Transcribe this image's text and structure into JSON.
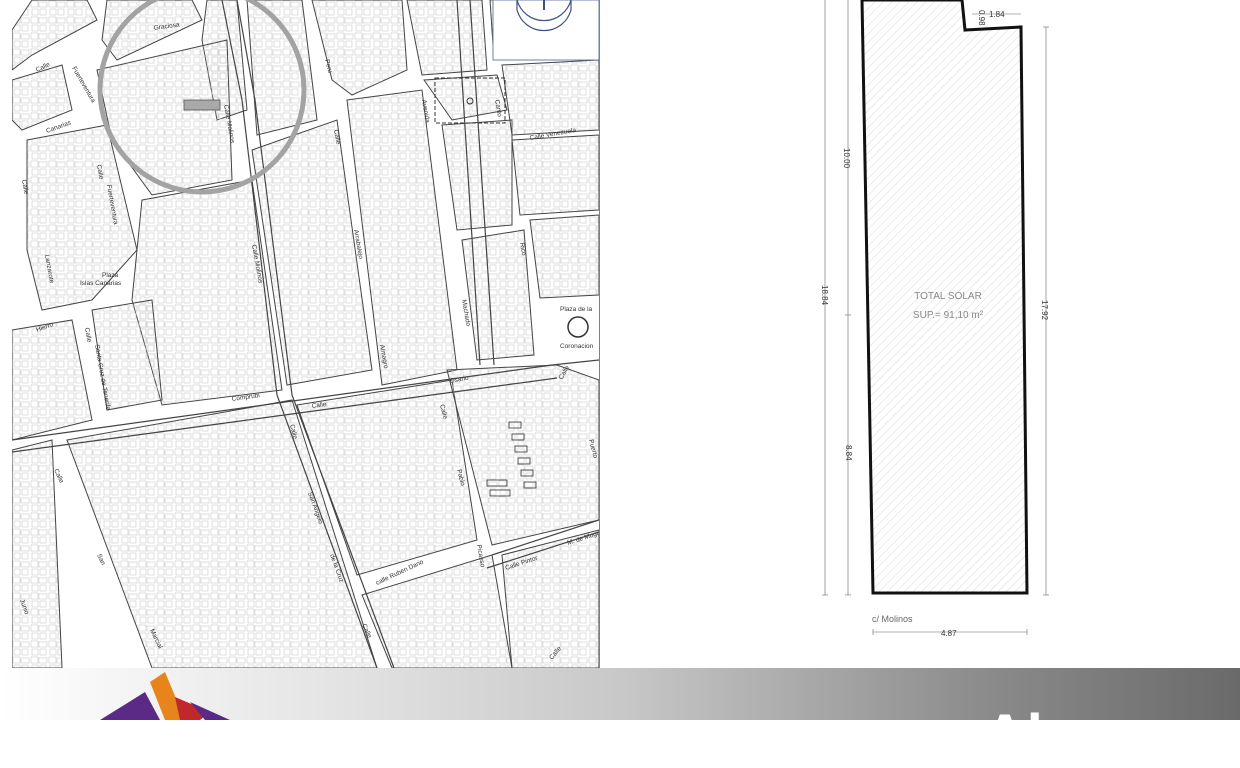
{
  "map": {
    "streets": {
      "graciosa": "Graciosa",
      "calle": "Calle",
      "fuerteventura": "Fuerteventura",
      "canarias": "Canarias",
      "calle_molinos": "Calle Molinos",
      "peru": "Peru",
      "avenida": "Avenida",
      "canto": "Canto",
      "calle_venezuela": "Calle Venezuela",
      "arrabalejo": "Arrabalejo",
      "almagro": "Almagro",
      "machado": "Machado",
      "rico": "Rico",
      "lanzarote": "Lanzarote",
      "plaza_islas_1": "Plaza",
      "plaza_islas_2": "Islas Canarias",
      "hierro": "Hierro",
      "santa_cruz": "Santa Cruz de Tenerife",
      "plaza_coronacion_1": "Plaza de la",
      "plaza_coronacion_2": "Coronacion",
      "osario": "Osario",
      "comprubi": "Comprubi",
      "puerto": "Puerto",
      "pablo": "Pablo",
      "san_angelo": "San Angelo",
      "de_la_cruz": "de la Cruz",
      "ruben_dario": "calle Ruben Dario",
      "picasso": "Picasso",
      "calle_pintor": "Calle Pintor",
      "m_de_moguer": "M. de Moguer",
      "san": "San",
      "junio": "Junio",
      "marcial": "Marcial"
    }
  },
  "plan": {
    "title": "TOTAL SOLAR",
    "area": "SUP.= 91,10 m²",
    "street_label": "c/ Molinos",
    "dims": {
      "top_step": "0.98",
      "top_width": "1.84",
      "left_upper": "10.00",
      "left_total": "18.84",
      "left_lower": "8.84",
      "right_total": "17.92",
      "bottom_width": "4.87"
    }
  },
  "footer": {
    "brand_text": "Ahorra",
    "colors": {
      "logo_purple": "#5b2a86",
      "logo_orange": "#e8841c",
      "logo_red": "#c0282c"
    }
  }
}
